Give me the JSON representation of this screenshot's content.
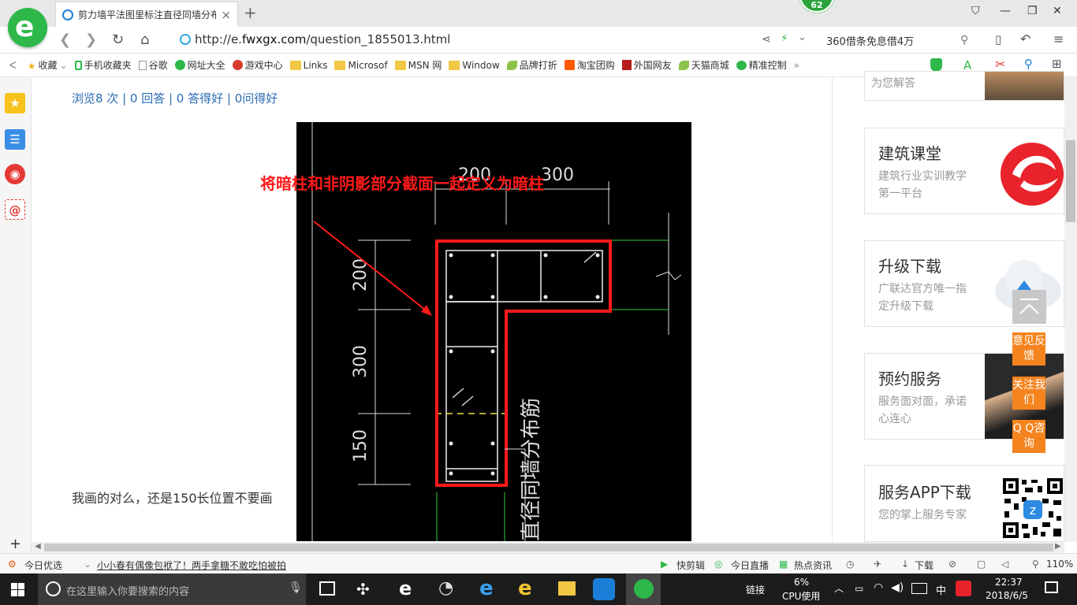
{
  "tab": {
    "title": "剪力墙平法图里标注直径同墙分布",
    "close": "×",
    "new": "+"
  },
  "badge": "62",
  "window_controls": [
    "⛉",
    "—",
    "❐",
    "✕"
  ],
  "address": {
    "url_prefix": "http://e.",
    "url_domain": "fwxgx.com",
    "url_path": "/question_1855013.html",
    "search_text": "360借条免息借4万"
  },
  "bookmarks": [
    {
      "label": "收藏",
      "icon": "star-icon"
    },
    {
      "label": "手机收藏夹",
      "icon": "phone-icon"
    },
    {
      "label": "谷歌",
      "icon": "page-icon"
    },
    {
      "label": "网址大全",
      "icon": "globe-icon"
    },
    {
      "label": "游戏中心",
      "icon": "game-icon"
    },
    {
      "label": "Links",
      "icon": "folder-icon"
    },
    {
      "label": "Microsof",
      "icon": "folder-icon"
    },
    {
      "label": "MSN 网",
      "icon": "folder-icon"
    },
    {
      "label": "Window",
      "icon": "folder-icon"
    },
    {
      "label": "品牌打折",
      "icon": "leaf-icon"
    },
    {
      "label": "淘宝团购",
      "icon": "taobao-icon"
    },
    {
      "label": "外国网友",
      "icon": "flag-icon"
    },
    {
      "label": "天猫商城",
      "icon": "leaf-icon"
    },
    {
      "label": "精准控制",
      "icon": "wechat-icon"
    }
  ],
  "stats": "浏览8 次 | 0 回答 | 0 答得好 | 0问得好",
  "drawing": {
    "annotation": "将暗柱和非阴影部分截面一起定义为暗柱",
    "dim_top": [
      "200",
      "300"
    ],
    "dim_left": [
      "200",
      "300",
      "150"
    ],
    "vertical_label": "直径同墙分布筋"
  },
  "question": "我画的对么，还是150长位置不要画",
  "cards": [
    {
      "title": "",
      "sub": "为您解答"
    },
    {
      "title": "建筑课堂",
      "sub": "建筑行业实训教学第一平台"
    },
    {
      "title": "升级下载",
      "sub": "广联达官方唯一指定升级下载"
    },
    {
      "title": "预约服务",
      "sub": "服务面对面，承诺心连心"
    },
    {
      "title": "服务APP下载",
      "sub": "您的掌上服务专家"
    }
  ],
  "float_buttons": [
    "意见反馈",
    "关注我们",
    "Q Q咨询"
  ],
  "statusbar": {
    "today": "今日优选",
    "news": "小小春有偶像包袱了！两手拿糖不敢吃怕被拍",
    "kuaijian": "快剪辑",
    "live": "今日直播",
    "hot": "热点资讯",
    "download": "下载",
    "zoom": "110%"
  },
  "taskbar": {
    "search_placeholder": "在这里输入你要搜索的内容",
    "link": "链接",
    "cpu_pct": "6%",
    "cpu_label": "CPU使用",
    "ime": "中",
    "time": "22:37",
    "date": "2018/6/5"
  },
  "colors": {
    "accent": "#2fb84a",
    "link": "#2b6cb3",
    "float": "#f5841f",
    "red": "#ff1a1a"
  }
}
